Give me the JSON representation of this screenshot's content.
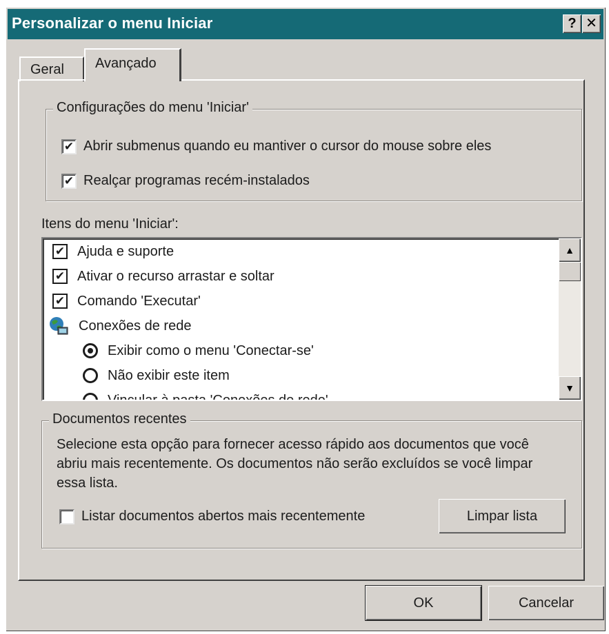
{
  "window": {
    "title": "Personalizar o menu Iniciar",
    "help_button": "?",
    "close_button": "✕"
  },
  "tabs": [
    {
      "label": "Geral",
      "active": false
    },
    {
      "label": "Avançado",
      "active": true
    }
  ],
  "start_menu_settings": {
    "legend": "Configurações do menu 'Iniciar'",
    "options": [
      {
        "label": "Abrir submenus quando eu mantiver o cursor do mouse sobre eles",
        "checked": true
      },
      {
        "label": "Realçar programas recém-instalados",
        "checked": true
      }
    ]
  },
  "start_menu_items": {
    "label": "Itens do menu 'Iniciar':",
    "items": [
      {
        "label": "Ajuda e suporte",
        "type": "checkbox",
        "checked": true
      },
      {
        "label": "Ativar o recurso arrastar e soltar",
        "type": "checkbox",
        "checked": true
      },
      {
        "label": "Comando 'Executar'",
        "type": "checkbox",
        "checked": true
      },
      {
        "label": "Conexões de rede",
        "type": "group",
        "icon": "network-connections-icon"
      },
      {
        "label": "Exibir como o menu 'Conectar-se'",
        "type": "radio",
        "selected": true
      },
      {
        "label": "Não exibir este item",
        "type": "radio",
        "selected": false
      },
      {
        "label": "Vincular à pasta 'Conexões de rede'",
        "type": "radio",
        "selected": false
      }
    ]
  },
  "recent_documents": {
    "legend": "Documentos recentes",
    "description": "Selecione esta opção para fornecer acesso rápido aos documentos que você abriu mais recentemente. Os documentos não serão excluídos se você limpar essa lista.",
    "checkbox_label": "Listar documentos abertos mais recentemente",
    "checked": false,
    "clear_button": "Limpar lista"
  },
  "footer": {
    "ok": "OK",
    "cancel": "Cancelar"
  },
  "colors": {
    "titlebar": "#156a76",
    "dialog_bg": "#d6d2cd"
  }
}
